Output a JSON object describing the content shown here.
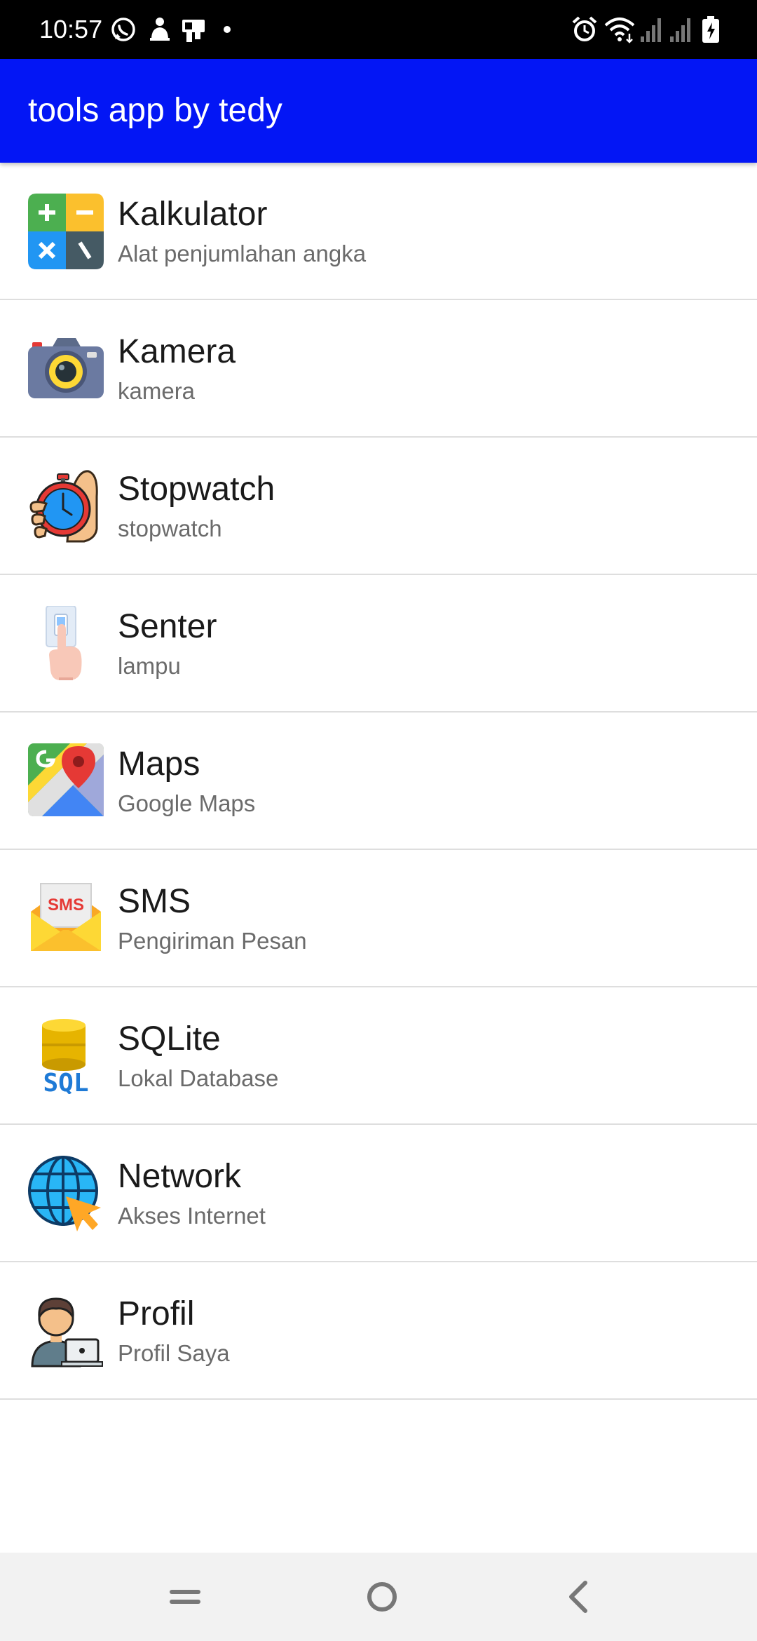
{
  "status_bar": {
    "time": "10:57",
    "icons": [
      "whatsapp-icon",
      "notification-icon",
      "notification-icon",
      "dot-icon",
      "alarm-icon",
      "wifi-icon",
      "signal-icon",
      "signal-icon",
      "battery-charging-icon"
    ]
  },
  "app_bar": {
    "title": "tools app by tedy",
    "color": "#0316f5"
  },
  "menu": {
    "items": [
      {
        "title": "Kalkulator",
        "subtitle": "Alat penjumlahan angka",
        "icon": "calculator-icon"
      },
      {
        "title": "Kamera",
        "subtitle": "kamera",
        "icon": "camera-icon"
      },
      {
        "title": "Stopwatch",
        "subtitle": "stopwatch",
        "icon": "stopwatch-icon"
      },
      {
        "title": "Senter",
        "subtitle": "lampu",
        "icon": "flashlight-switch-icon"
      },
      {
        "title": "Maps",
        "subtitle": "Google Maps",
        "icon": "maps-icon"
      },
      {
        "title": "SMS",
        "subtitle": "Pengiriman Pesan",
        "icon": "sms-icon"
      },
      {
        "title": "SQLite",
        "subtitle": "Lokal Database",
        "icon": "sql-database-icon"
      },
      {
        "title": "Network",
        "subtitle": "Akses Internet",
        "icon": "globe-network-icon"
      },
      {
        "title": "Profil",
        "subtitle": "Profil Saya",
        "icon": "profile-icon"
      }
    ],
    "icon_labels": {
      "sms": "SMS",
      "sql": "SQL"
    }
  },
  "nav_bar": {
    "buttons": [
      "recents-icon",
      "home-icon",
      "back-icon"
    ]
  }
}
